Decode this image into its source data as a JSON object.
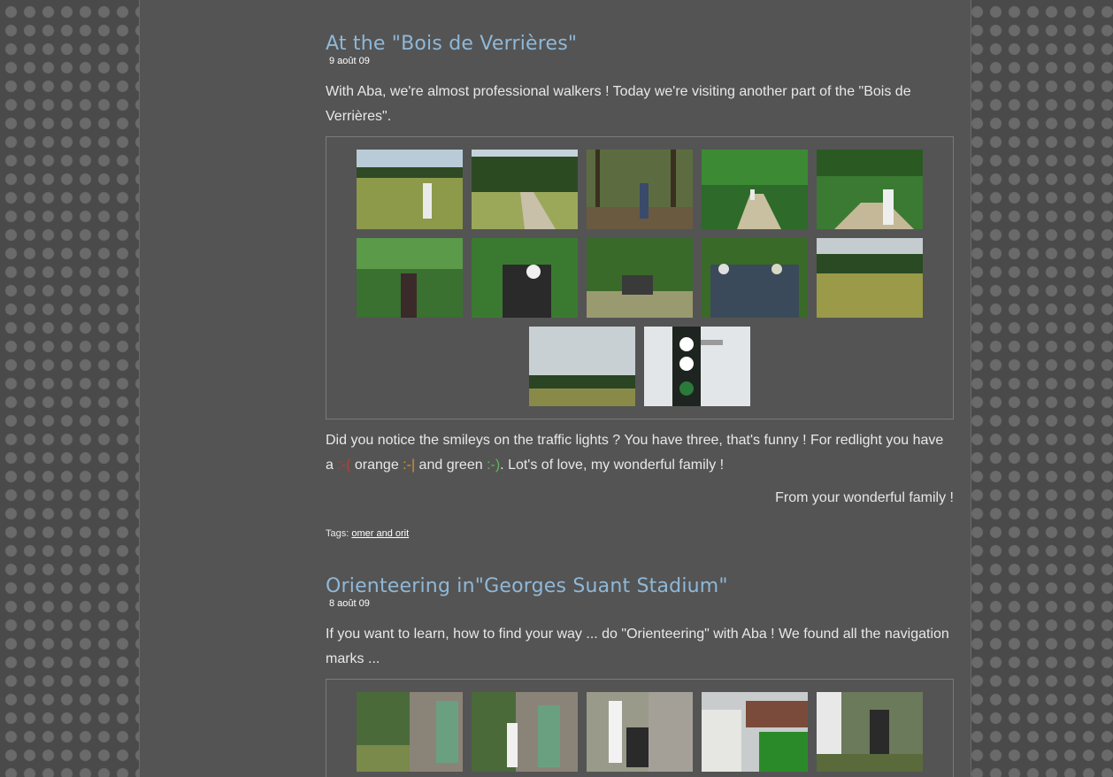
{
  "posts": [
    {
      "title": "At the \"Bois de Verrières\"",
      "date": "9 août 09",
      "intro": "With Aba, we're almost professional walkers ! Today we're visiting another part of the \"Bois de Verrières\".",
      "outro_part1": "Did you notice the smileys on the traffic lights ? You have three, that's funny ! For redlight you have a ",
      "smiley_red": ":-(",
      "outro_part2": " orange ",
      "smiley_orange": ":-|",
      "outro_part3": " and green ",
      "smiley_green": ":-)",
      "outro_part4": ". Lot's of love, my wonderful family !",
      "signature": "From your wonderful family !",
      "tags_label": "Tags:",
      "tag": "omer and orit"
    },
    {
      "title": "Orienteering in\"Georges Suant Stadium\"",
      "date": "8 août 09",
      "intro": "If you want to learn, how to find your way ... do \"Orienteering\" with Aba ! We found all the navigation marks ..."
    }
  ]
}
